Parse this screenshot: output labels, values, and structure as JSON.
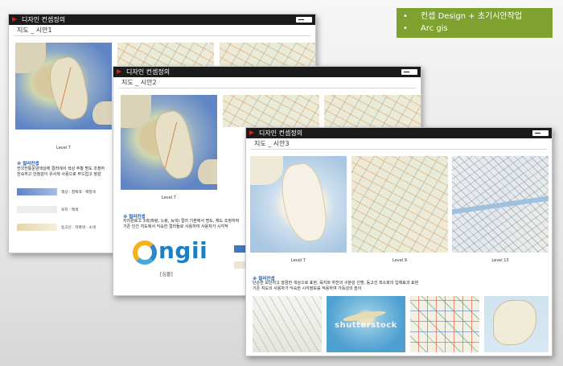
{
  "summary": {
    "bullets": [
      "컨셉 Design + 초기시안작업",
      "Arc gis"
    ],
    "color": "#7fa12f"
  },
  "slide1": {
    "title": "디자인 컨셉정의",
    "subtitle": "지도 _ 시안1",
    "map_caption": "Level 7",
    "note_title": "※ 컬러컨셉",
    "note_text": "한국전통문양색상에 컬러에서 색상 주황 명도 조정하\n친숙하고 안정감이 유사색 사용으로 부드럽고 정감",
    "legend": [
      {
        "label": "해상 : 청백색 - 백청색",
        "color": "#7f9dcb"
      },
      {
        "label": "육지 : 백색",
        "color": "#ececec"
      },
      {
        "label": "등고선 : 지백색 - 소색",
        "color": "#efe2c2"
      }
    ]
  },
  "slide2": {
    "title": "디자인 컨셉정의",
    "subtitle": "지도 _ 시안2",
    "map_caption": "Level 7",
    "note_title": "※ 컬러컨셉",
    "note_text": "지리원로고 3색(파랑, 노랑, 녹색) 컬러 기본에서 명도, 채도 조정하여\n기존 인간 지도에서 익숙한 컬러들로 사용하여 사용자가 시각적",
    "logo_text": "ngii",
    "logo_sub": "[심볼]",
    "swatches": [
      "#3f78c2",
      "#efe6d2"
    ]
  },
  "slide3": {
    "title": "디자인 컨셉정의",
    "subtitle": "지도 _ 시안3",
    "captions": [
      "Level 7",
      "Level 9",
      "Level 13"
    ],
    "note_title": "※ 컬러컨셉",
    "note_text": "단순한 모던하고 깔끔한 색상으로 표현, 육지와 하천의 구분감 선명, 등고선 최소화의 입체효과 표현\n기존 지도의 사용자가 익숙한 시각정보를 적용하여 가독성의 높이",
    "ref_watermark": "shutterstock"
  }
}
